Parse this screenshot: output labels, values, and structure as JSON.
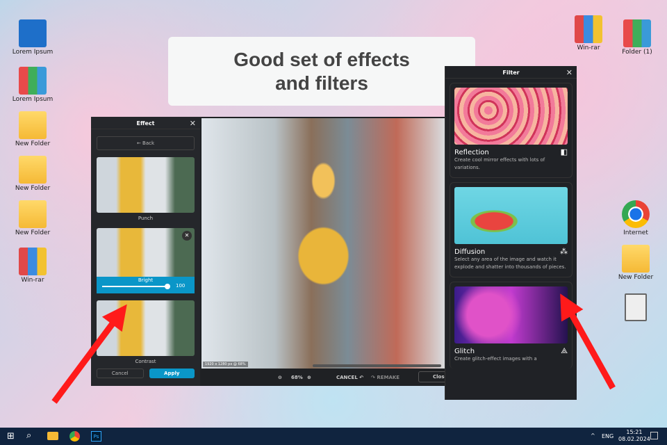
{
  "desktop": {
    "left": [
      "Lorem Ipsum",
      "Lorem Ipsum",
      "New Folder",
      "New Folder",
      "New Folder",
      "Win-rar"
    ],
    "right_top": [
      "Win-rar",
      "Folder (1)"
    ],
    "right_bottom": [
      "Internet",
      "New Folder"
    ]
  },
  "headline": "Good set of effects\nand filters",
  "effect_panel": {
    "title": "Effect",
    "back": "Back",
    "items": [
      "Punch",
      "Bright",
      "Contrast"
    ],
    "bright_value": "100",
    "bright_fraction": 1.0,
    "cancel": "Cancel",
    "apply": "Apply"
  },
  "canvas": {
    "info": "1920 x 1280 px @ 68%",
    "zoom": "68%",
    "cancel": "CANCEL",
    "remake": "REMAKE",
    "close": "Close"
  },
  "filter_panel": {
    "title": "Filter",
    "cards": [
      {
        "name": "Reflection",
        "desc": "Create cool mirror effects with lots of variations."
      },
      {
        "name": "Diffusion",
        "desc": "Select any area of the image and watch it explode and shatter into thousands of pieces."
      },
      {
        "name": "Glitch",
        "desc": "Create glitch-effect images with a"
      }
    ]
  },
  "taskbar": {
    "lang": "ENG",
    "time": "15:21",
    "date": "08.02.2024"
  },
  "colors": {
    "accent": "#0a96c8",
    "arrow": "#ff1a1a"
  }
}
